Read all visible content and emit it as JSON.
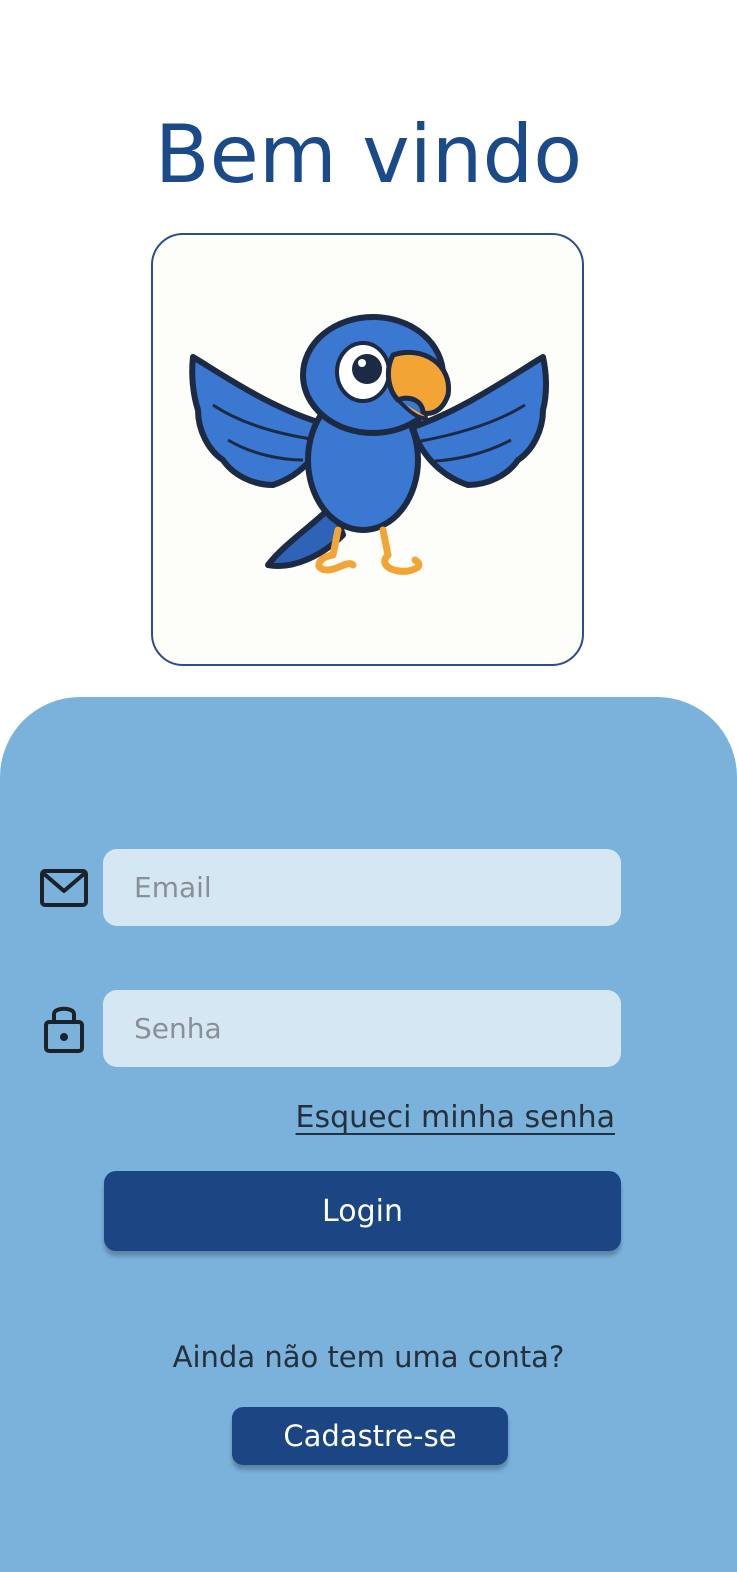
{
  "header": {
    "title": "Bem vindo"
  },
  "logo": {
    "icon": "blue-parrot-mascot"
  },
  "form": {
    "email": {
      "placeholder": "Email",
      "value": "",
      "icon": "mail-icon"
    },
    "password": {
      "placeholder": "Senha",
      "value": "",
      "icon": "lock-icon"
    },
    "forgot_label": "Esqueci minha senha",
    "login_label": "Login"
  },
  "signup": {
    "prompt": "Ainda não tem uma conta?",
    "button_label": "Cadastre-se"
  },
  "colors": {
    "title": "#1b4a8a",
    "panel": "#7bb2dc",
    "field_bg": "#d6e7f4",
    "button_bg": "#1b4583"
  }
}
